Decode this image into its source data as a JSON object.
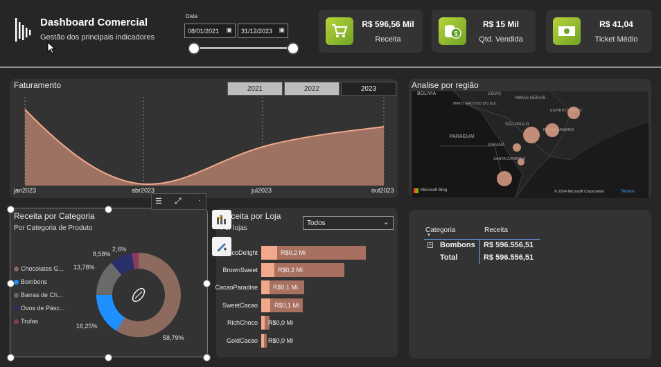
{
  "header": {
    "title": "Dashboard Comercial",
    "subtitle": "Gestão dos principais indicadores"
  },
  "date_filter": {
    "label": "Data",
    "start": "08/01/2021",
    "end": "31/12/2023"
  },
  "kpis": [
    {
      "value": "R$ 596,56 Mil",
      "label": "Receita",
      "icon": "cart-icon"
    },
    {
      "value": "R$ 15 Mil",
      "label": "Qtd. Vendida",
      "icon": "coins-icon"
    },
    {
      "value": "R$ 41,04",
      "label": "Ticket Médio",
      "icon": "cash-icon"
    }
  ],
  "faturamento": {
    "title": "Faturamento",
    "years": [
      "2021",
      "2022",
      "2023"
    ],
    "selected_year": "2023",
    "x_labels": [
      "jan2023",
      "abr2023",
      "jul2023",
      "out2023"
    ]
  },
  "regiao": {
    "title": "Analise por região",
    "map_labels": [
      "BOLIVIA",
      "GOIAS",
      "MATO GROSSO DO SUL",
      "MINAS GERAIS",
      "ESPÍRITO SANTO",
      "SÃO PAULO",
      "RIO DE JANEIRO",
      "PARAGUAI",
      "PARANÁ",
      "SANTA CATARINA"
    ],
    "attribution": "Microsoft Bing",
    "copyright": "© 2024 Microsoft Corporation",
    "terms": "Termos"
  },
  "categoria": {
    "title": "Receita por Categoria",
    "subtitle": "Por Categoria de Produto",
    "legend": [
      {
        "name": "Chocolates G...",
        "color": "#8c6a5e"
      },
      {
        "name": "Bombons",
        "color": "#1e90ff"
      },
      {
        "name": "Barras de Ch...",
        "color": "#6a6a6a"
      },
      {
        "name": "Ovos de Pásc...",
        "color": "#2a2f6a"
      },
      {
        "name": "Trufas",
        "color": "#8a3a5c"
      }
    ],
    "percent_labels": [
      "58,79%",
      "16,25%",
      "13,78%",
      "8,58%",
      "2,6%"
    ]
  },
  "chart_data": {
    "type": "pie",
    "title": "Receita por Categoria",
    "categories": [
      "Chocolates G...",
      "Bombons",
      "Barras de Ch...",
      "Ovos de Pásc...",
      "Trufas"
    ],
    "values": [
      58.79,
      16.25,
      13.78,
      8.58,
      2.6
    ]
  },
  "loja": {
    "title": "Receita por Loja",
    "subtitle": "Por lojas",
    "dropdown": "Todos",
    "stores": [
      {
        "name": "ChocoDelight",
        "label": "R$0,2 Mi",
        "value": 0.2
      },
      {
        "name": "BrownSweet",
        "label": "R$0,2 Mi",
        "value": 0.2
      },
      {
        "name": "CacaoParadise",
        "label": "R$0,1 Mi",
        "value": 0.1
      },
      {
        "name": "SweetCacao",
        "label": "R$0,1 Mi",
        "value": 0.1
      },
      {
        "name": "RichChoco",
        "label": "R$0,0 Mi",
        "value": 0.0
      },
      {
        "name": "GoldCacao",
        "label": "R$0,0 Mi",
        "value": 0.0
      }
    ]
  },
  "tabela": {
    "col_categoria": "Categoria",
    "col_receita": "Receita",
    "rows": [
      {
        "categoria": "Bombons",
        "receita": "R$ 596.556,51"
      },
      {
        "categoria": "Total",
        "receita": "R$ 596.556,51"
      }
    ]
  }
}
